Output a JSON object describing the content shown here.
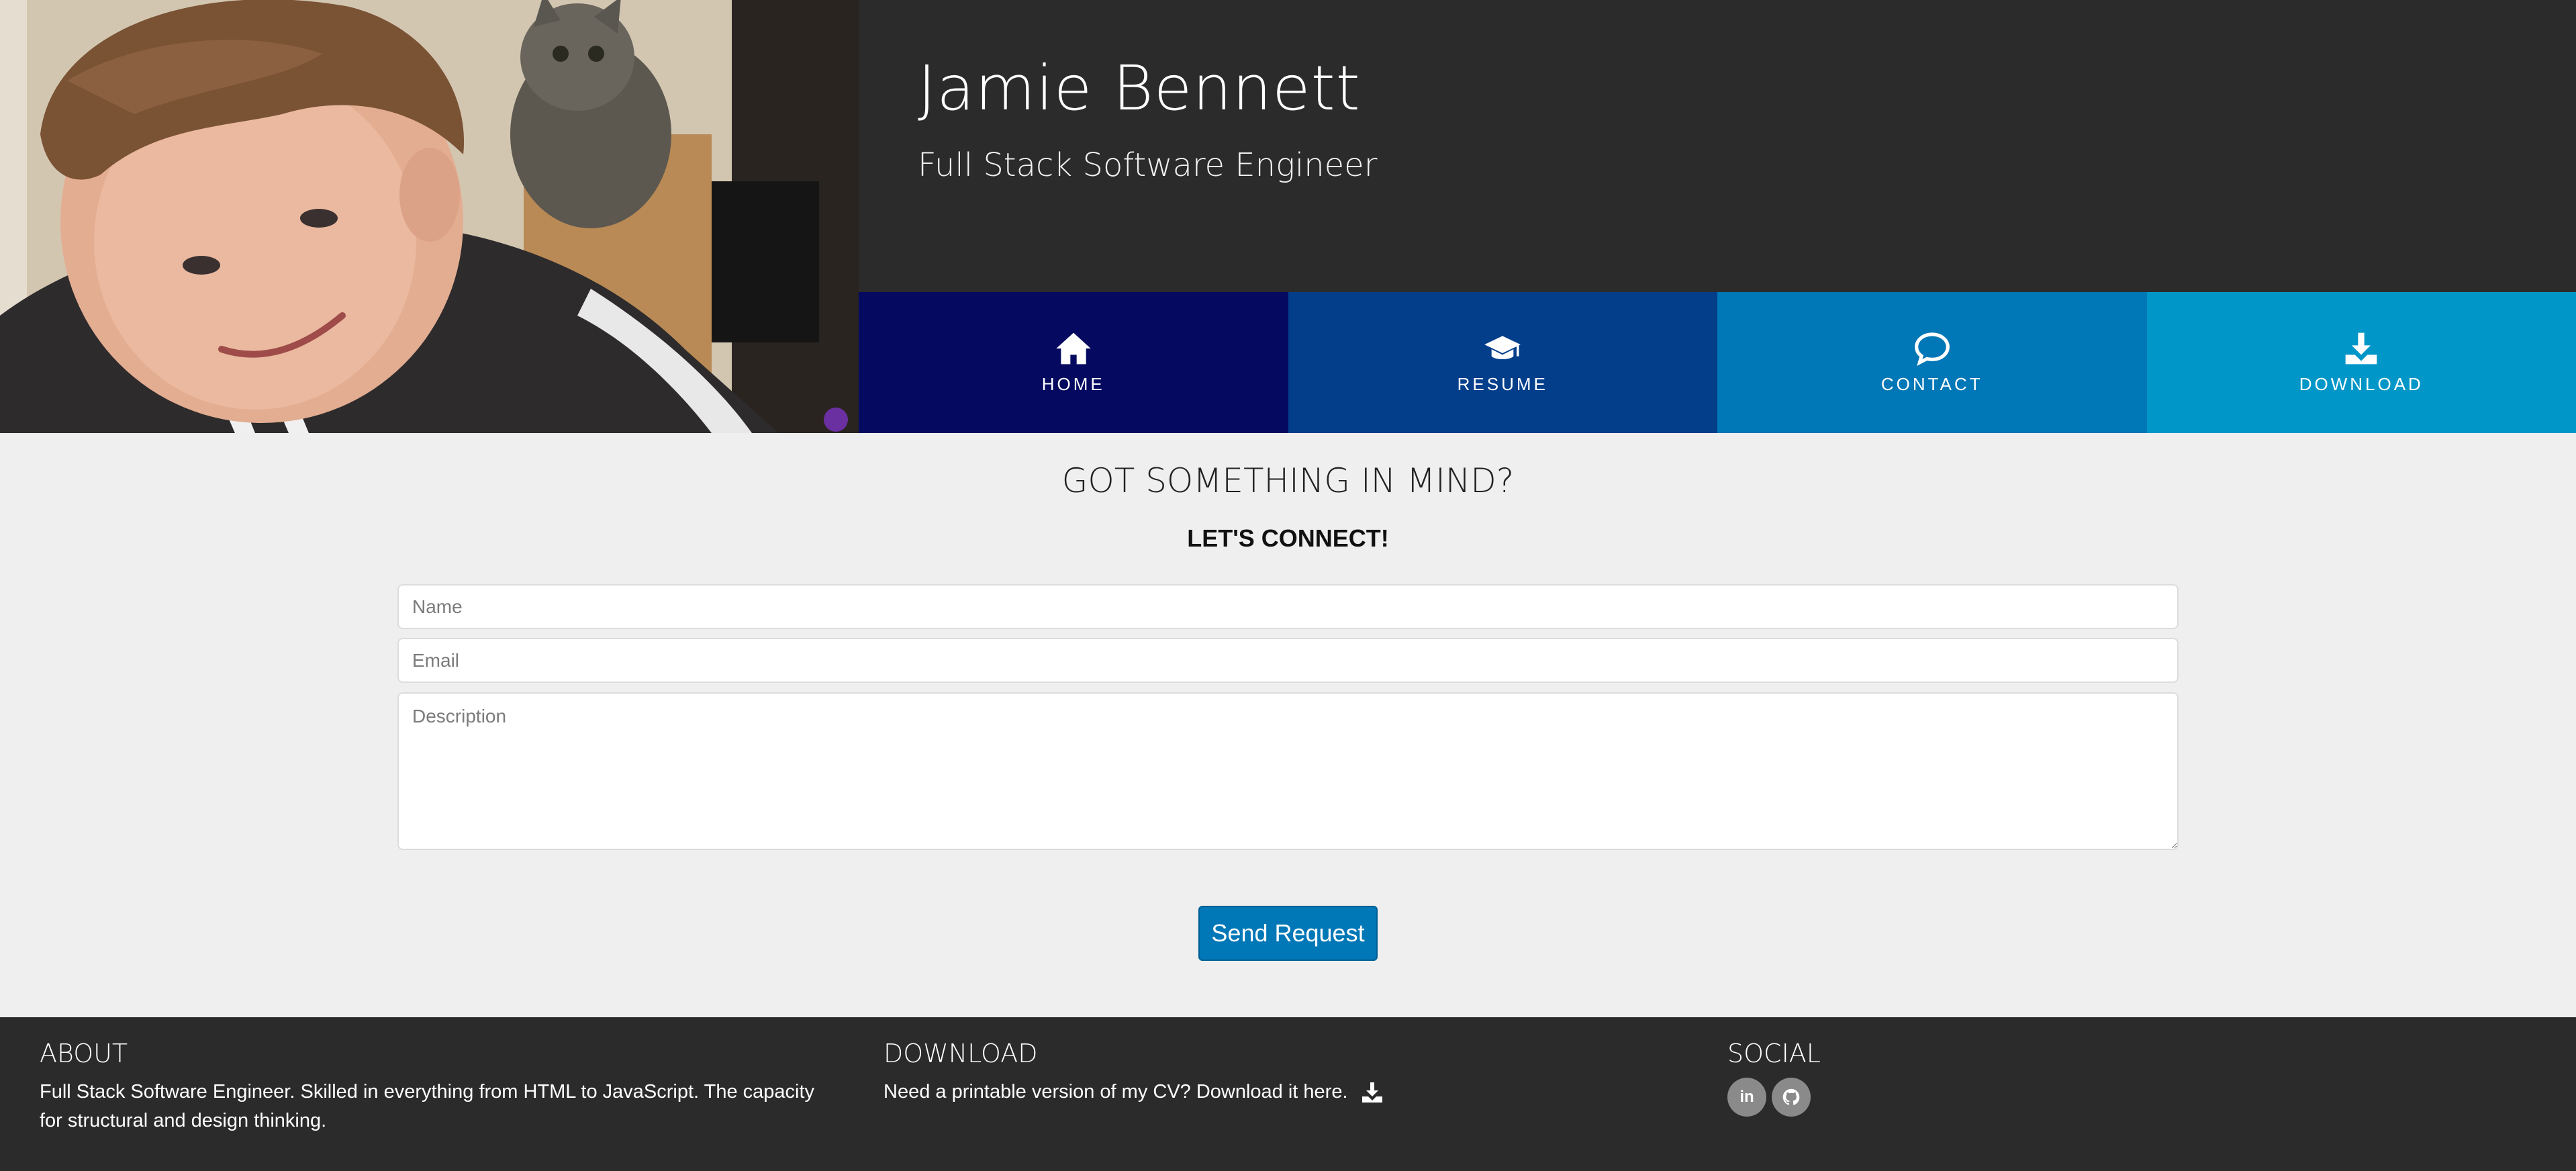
{
  "header": {
    "name": "Jamie Bennett",
    "title": "Full Stack Software Engineer"
  },
  "nav": [
    {
      "label": "HOME",
      "icon": "home-icon",
      "color": "#050a60"
    },
    {
      "label": "RESUME",
      "icon": "graduation-cap-icon",
      "color": "#023e8a"
    },
    {
      "label": "CONTACT",
      "icon": "chat-bubble-icon",
      "color": "#0077b6"
    },
    {
      "label": "DOWNLOAD",
      "icon": "download-icon",
      "color": "#0096c7"
    }
  ],
  "contact": {
    "heading": "GOT SOMETHING IN MIND?",
    "subheading": "LET'S CONNECT!",
    "name_placeholder": "Name",
    "email_placeholder": "Email",
    "description_placeholder": "Description",
    "send_label": "Send Request"
  },
  "footer": {
    "about": {
      "heading": "ABOUT",
      "text": "Full Stack Software Engineer. Skilled in everything from HTML to JavaScript. The capacity for structural and design thinking."
    },
    "download": {
      "heading": "DOWNLOAD",
      "text": "Need a printable version of my CV? Download it here."
    },
    "social": {
      "heading": "SOCIAL",
      "links": [
        {
          "label": "in",
          "icon": "linkedin-icon"
        },
        {
          "label": "",
          "icon": "github-icon"
        }
      ]
    }
  },
  "colors": {
    "banner": "#2b2b2b",
    "page_bg": "#efefef",
    "button": "#0077b6",
    "footer": "#2b2b2b"
  }
}
